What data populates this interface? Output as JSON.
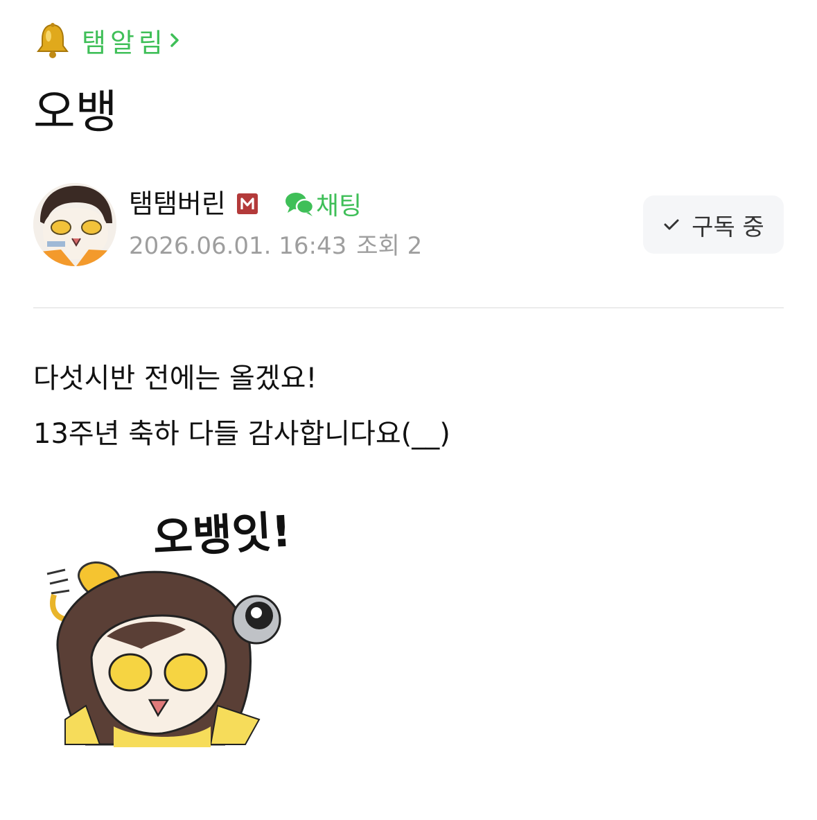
{
  "board": {
    "icon": "bell-icon",
    "label": "탬알림",
    "arrow_icon": "chevron-right-icon"
  },
  "post": {
    "title": "오뱅",
    "body": [
      "다섯시반 전에는 올겠요!",
      "13주년 축하 다들 감사합니다요(__)"
    ]
  },
  "author": {
    "name": "탬탬버린",
    "badge_letter": "M",
    "chat_label": "채팅",
    "date": "2026.06.01. 16:43",
    "views": "조회 2"
  },
  "subscribe": {
    "label": "구독 중",
    "icon": "check-icon"
  },
  "sticker": {
    "text": "오뱅잇!"
  },
  "colors": {
    "accent_green": "#3fbf58",
    "badge_red": "#b33a3a",
    "meta_gray": "#9e9e9e",
    "button_bg": "#f5f6f8"
  }
}
